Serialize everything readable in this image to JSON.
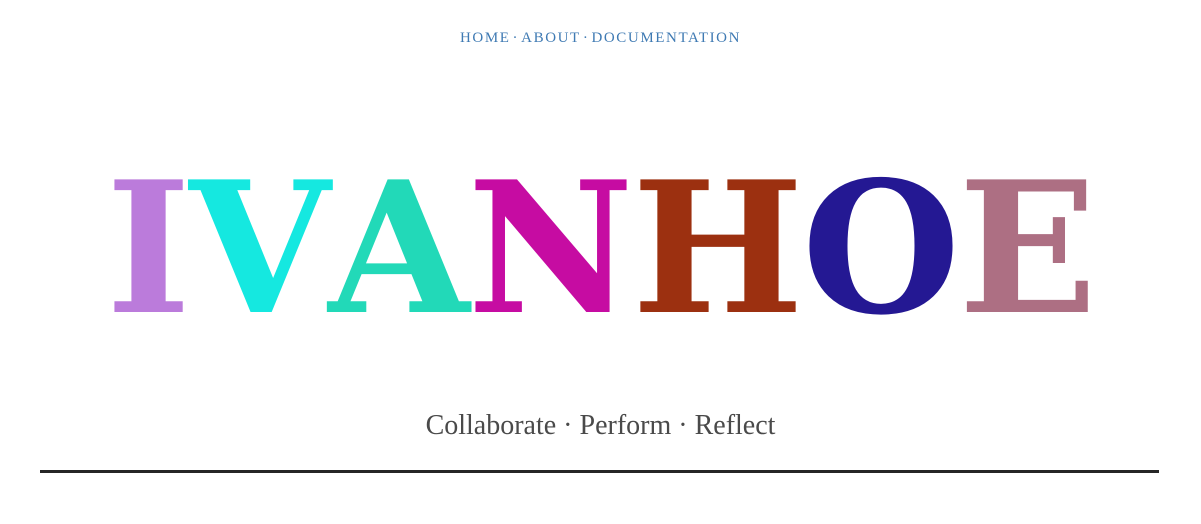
{
  "nav": {
    "items": [
      {
        "label": "HOME"
      },
      {
        "label": "ABOUT"
      },
      {
        "label": "DOCUMENTATION"
      }
    ],
    "separator": "·"
  },
  "logo": {
    "letters": [
      {
        "char": "I",
        "color": "#bb7bdb"
      },
      {
        "char": "V",
        "color": "#15e8e0"
      },
      {
        "char": "A",
        "color": "#22d9b8"
      },
      {
        "char": "N",
        "color": "#c60ca2"
      },
      {
        "char": "H",
        "color": "#9c3010"
      },
      {
        "char": "O",
        "color": "#241893"
      },
      {
        "char": "E",
        "color": "#ad6f83"
      }
    ]
  },
  "tagline": {
    "text": "Collaborate · Perform · Reflect"
  },
  "colors": {
    "link": "#3f7ab3",
    "tagline": "#4a4a4a",
    "rule": "#262626"
  }
}
